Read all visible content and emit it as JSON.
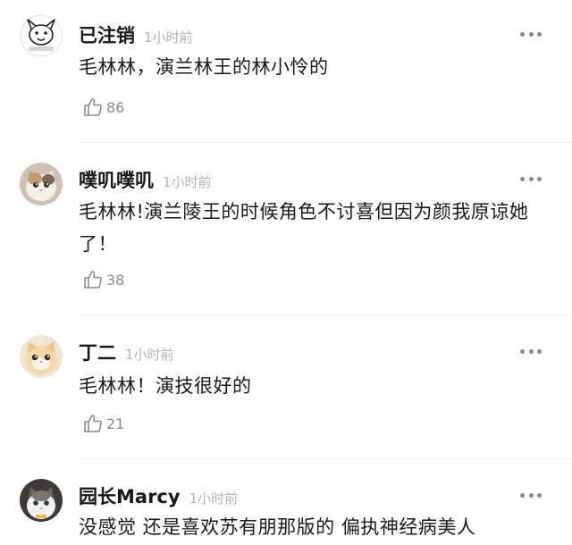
{
  "colors": {
    "text": "#1a1a1a",
    "muted": "#b4b4b4",
    "icon": "#8c8c8c",
    "divider": "#ececec"
  },
  "comments": [
    {
      "username": "已注销",
      "time": "1小时前",
      "text": "毛林林，演兰林王的林小怜的",
      "likes": "86",
      "avatar_icon": "cartoon-face-icon"
    },
    {
      "username": "噗叽噗叽",
      "time": "1小时前",
      "text": "毛林林!演兰陵王的时候角色不讨喜但因为颜我原谅她了！",
      "likes": "38",
      "avatar_icon": "cat-photo-icon"
    },
    {
      "username": "丁二",
      "time": "1小时前",
      "text": "毛林林！演技很好的",
      "likes": "21",
      "avatar_icon": "cat-photo-icon"
    },
    {
      "username": "园长Marcy",
      "time": "1小时前",
      "text": "没感觉 还是喜欢苏有朋那版的 偏执神经病美人",
      "likes": "",
      "avatar_icon": "cat-photo-icon"
    }
  ]
}
